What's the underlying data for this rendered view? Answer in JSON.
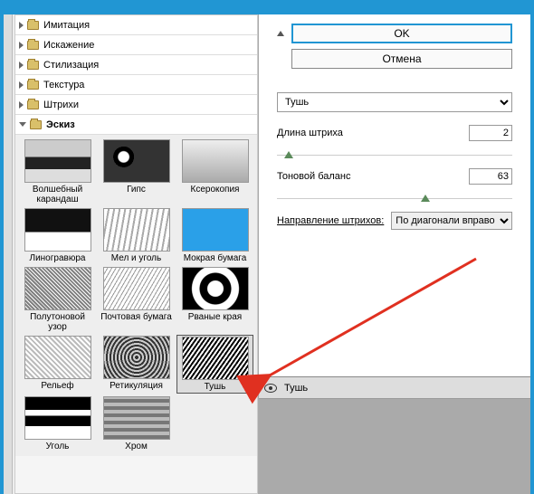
{
  "sidebar": {
    "categories": [
      {
        "label": "Имитация",
        "open": false
      },
      {
        "label": "Искажение",
        "open": false
      },
      {
        "label": "Стилизация",
        "open": false
      },
      {
        "label": "Текстура",
        "open": false
      },
      {
        "label": "Штрихи",
        "open": false
      },
      {
        "label": "Эскиз",
        "open": true
      }
    ],
    "filters": [
      {
        "label": "Волшебный карандаш"
      },
      {
        "label": "Гипс"
      },
      {
        "label": "Ксерокопия"
      },
      {
        "label": "Линогравюра"
      },
      {
        "label": "Мел и уголь"
      },
      {
        "label": "Мокрая бумага"
      },
      {
        "label": "Полутоновой узор"
      },
      {
        "label": "Почтовая бумага"
      },
      {
        "label": "Рваные края"
      },
      {
        "label": "Рельеф"
      },
      {
        "label": "Ретикуляция"
      },
      {
        "label": "Тушь",
        "selected": true
      },
      {
        "label": "Уголь"
      },
      {
        "label": "Хром"
      }
    ]
  },
  "buttons": {
    "ok": "OK",
    "cancel": "Отмена"
  },
  "controls": {
    "filter_name": "Тушь",
    "stroke_length_label": "Длина штриха",
    "stroke_length_value": "2",
    "tone_balance_label": "Тоновой баланс",
    "tone_balance_value": "63",
    "direction_label": "Направление штрихов:",
    "direction_value": "По диагонали вправо"
  },
  "layers": {
    "name": "Тушь"
  }
}
